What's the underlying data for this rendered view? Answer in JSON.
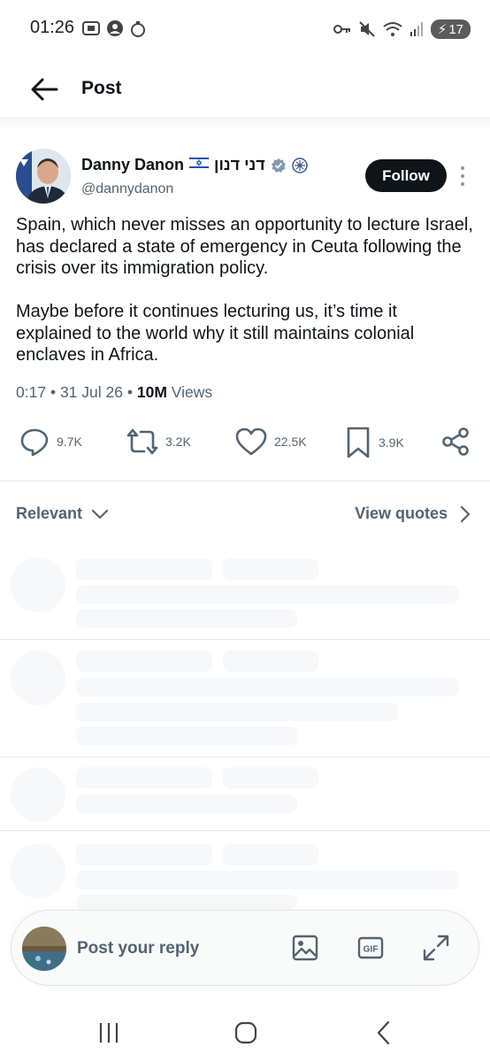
{
  "status_bar": {
    "time": "01:26",
    "battery": "17"
  },
  "header": {
    "title": "Post"
  },
  "author": {
    "name": "Danny Danon",
    "flag": "🇮🇱",
    "hebrew_name": "דני דנון",
    "handle": "@dannydanon"
  },
  "follow_label": "Follow",
  "post": {
    "paragraph_1": "Spain, which never misses an opportunity to lecture Israel, has declared a state of emergency in Ceuta following the crisis over its immigration policy.",
    "paragraph_2": "Maybe before it continues lecturing us, it’s time it explained to the world why it still maintains colonial enclaves in Africa."
  },
  "meta": {
    "time": "0:17",
    "date": "31 Jul 26",
    "views_count": "10M",
    "views_label": "Views",
    "separator": "•"
  },
  "actions": {
    "replies": "9.7K",
    "reposts": "3.2K",
    "likes": "22.5K",
    "bookmarks": "3.9K"
  },
  "sort": {
    "label": "Relevant"
  },
  "view_quotes_label": "View quotes",
  "composer": {
    "placeholder": "Post your reply"
  },
  "colors": {
    "accent": "#0f1419",
    "muted": "#536471",
    "verified": "#829aab"
  }
}
